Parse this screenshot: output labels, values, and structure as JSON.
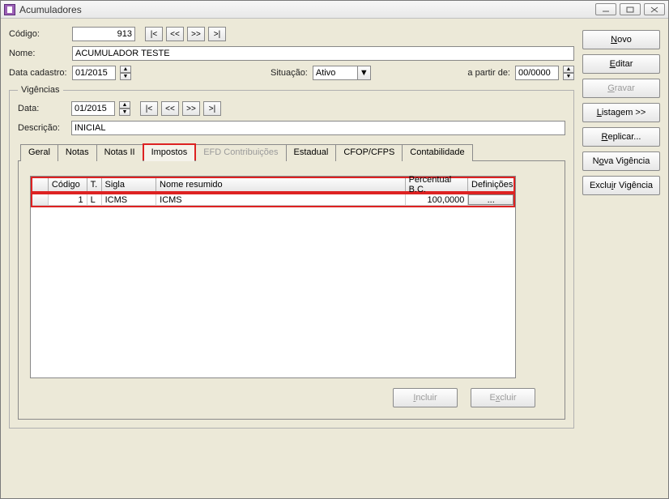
{
  "window": {
    "title": "Acumuladores"
  },
  "header": {
    "codigo_label": "Código:",
    "codigo_value": "913",
    "nome_label": "Nome:",
    "nome_value": "ACUMULADOR TESTE",
    "data_cadastro_label": "Data cadastro:",
    "data_cadastro_value": "01/2015",
    "situacao_label": "Situação:",
    "situacao_value": "Ativo",
    "apartirde_label": "a partir de:",
    "apartirde_value": "00/0000"
  },
  "nav": {
    "first": "|<",
    "prev": "<<",
    "next": ">>",
    "last": ">|"
  },
  "vigencias": {
    "legend": "Vigências",
    "data_label": "Data:",
    "data_value": "01/2015",
    "descricao_label": "Descrição:",
    "descricao_value": "INICIAL"
  },
  "tabs": {
    "geral": "Geral",
    "notas": "Notas",
    "notas2": "Notas II",
    "impostos": "Impostos",
    "efd": "EFD Contribuições",
    "estadual": "Estadual",
    "cfop": "CFOP/CFPS",
    "contab": "Contabilidade"
  },
  "grid": {
    "headers": {
      "codigo": "Código",
      "t": "T.",
      "sigla": "Sigla",
      "nome": "Nome resumido",
      "perc": "Percentual B.C.",
      "def": "Definições"
    },
    "rows": [
      {
        "codigo": "1",
        "t": "L",
        "sigla": "ICMS",
        "nome": "ICMS",
        "perc": "100,0000",
        "def": "..."
      }
    ]
  },
  "buttons": {
    "novo": "Novo",
    "editar": "Editar",
    "gravar": "Gravar",
    "listagem": "Listagem >>",
    "replicar": "Replicar...",
    "nova_vig": "Nova Vigência",
    "excluir_vig": "Excluir Vigência",
    "incluir": "Incluir",
    "excluir": "Excluir"
  }
}
